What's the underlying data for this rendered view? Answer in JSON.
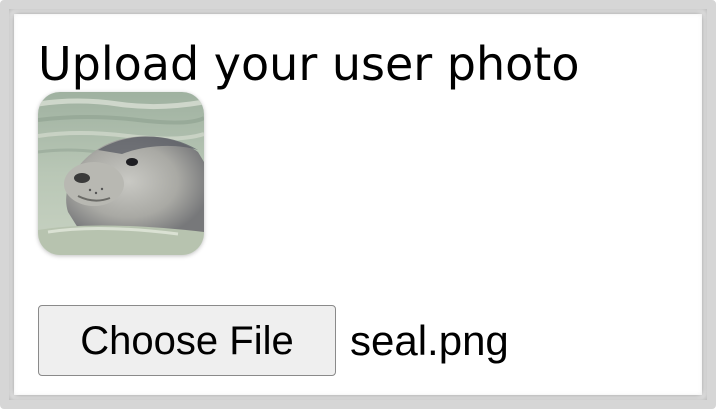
{
  "upload": {
    "title": "Upload your user photo",
    "photo_alt": "seal",
    "choose_file_label": "Choose File",
    "selected_file_name": "seal.png"
  }
}
